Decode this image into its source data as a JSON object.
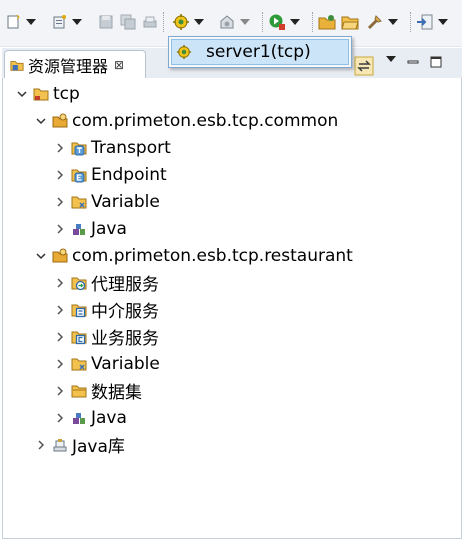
{
  "toolbar": {
    "icons": [
      "new-icon",
      "new-wizard-icon",
      "save-icon",
      "save-all-icon",
      "print-icon",
      "server-icon",
      "deploy-icon",
      "run-icon",
      "open-project-icon",
      "open-folder-icon",
      "tool-icon",
      "import-icon"
    ]
  },
  "popup": {
    "items": [
      {
        "label": "server1(tcp)",
        "icon": "server-icon"
      }
    ]
  },
  "view": {
    "tab_title": "资源管理器",
    "close_glyph": "⊠"
  },
  "tree": {
    "root": {
      "label": "tcp",
      "expanded": true
    },
    "items": [
      {
        "label": "com.primeton.esb.tcp.common",
        "level": 1,
        "expanded": true,
        "icon": "package-icon"
      },
      {
        "label": "Transport",
        "level": 2,
        "expanded": false,
        "icon": "transport-icon"
      },
      {
        "label": "Endpoint",
        "level": 2,
        "expanded": false,
        "icon": "endpoint-icon"
      },
      {
        "label": "Variable",
        "level": 2,
        "expanded": false,
        "icon": "variable-folder-icon"
      },
      {
        "label": "Java",
        "level": 2,
        "expanded": false,
        "icon": "java-icon"
      },
      {
        "label": "com.primeton.esb.tcp.restaurant",
        "level": 1,
        "expanded": true,
        "icon": "package-icon"
      },
      {
        "label": "代理服务",
        "level": 2,
        "expanded": false,
        "icon": "proxy-service-icon"
      },
      {
        "label": "中介服务",
        "level": 2,
        "expanded": false,
        "icon": "mediation-service-icon"
      },
      {
        "label": "业务服务",
        "level": 2,
        "expanded": false,
        "icon": "business-service-icon"
      },
      {
        "label": "Variable",
        "level": 2,
        "expanded": false,
        "icon": "variable-folder-icon"
      },
      {
        "label": "数据集",
        "level": 2,
        "expanded": false,
        "icon": "dataset-folder-icon"
      },
      {
        "label": "Java",
        "level": 2,
        "expanded": false,
        "icon": "java-icon"
      },
      {
        "label": "Java库",
        "level": 1,
        "expanded": false,
        "icon": "library-icon"
      }
    ]
  },
  "colors": {
    "selection": "#cce4f7",
    "popup_border": "#7fa9d3",
    "folder": "#f2c14e"
  }
}
